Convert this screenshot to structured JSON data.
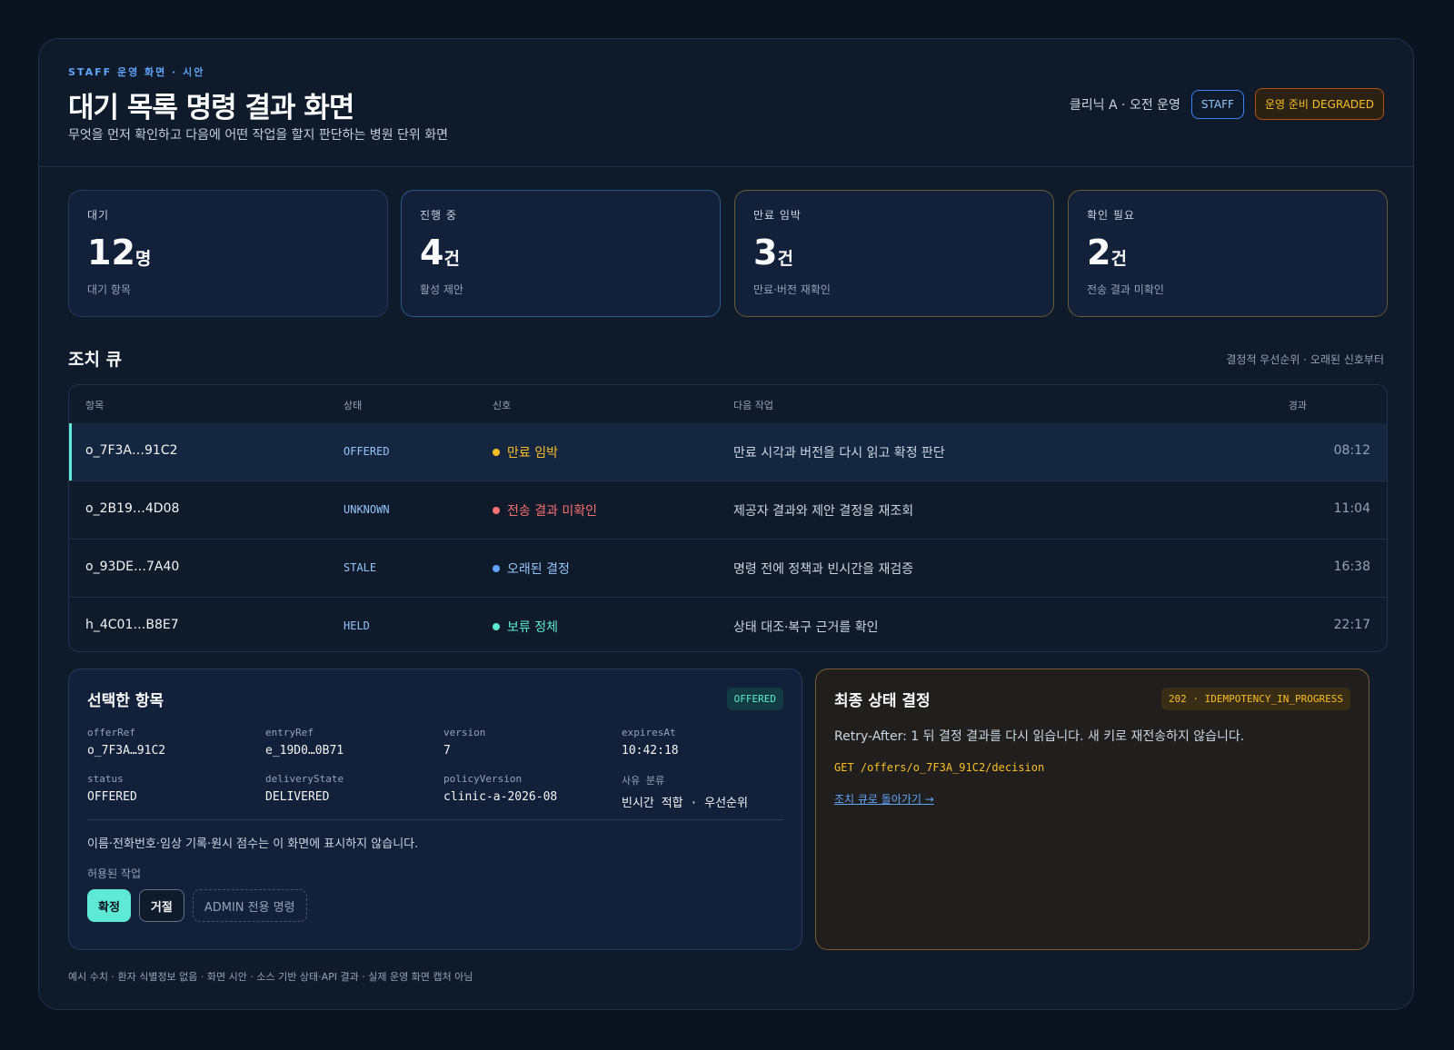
{
  "header": {
    "eyebrow": "STAFF 운영 화면 · 시안",
    "title": "대기 목록 명령 결과 화면",
    "subtitle": "무엇을 먼저 확인하고 다음에 어떤 작업을 할지 판단하는 병원 단위 화면",
    "clinic": "클리닉 A · 오전 운영",
    "role_badge": "STAFF",
    "ops_badge": "운영 준비 DEGRADED"
  },
  "stats": [
    {
      "label": "대기",
      "value": "12",
      "unit": "명",
      "desc": "대기 항목"
    },
    {
      "label": "진행 중",
      "value": "4",
      "unit": "건",
      "desc": "활성 제안"
    },
    {
      "label": "만료 임박",
      "value": "3",
      "unit": "건",
      "desc": "만료·버전 재확인"
    },
    {
      "label": "확인 필요",
      "value": "2",
      "unit": "건",
      "desc": "전송 결과 미확인"
    }
  ],
  "queue": {
    "title": "조치 큐",
    "note": "결정적 우선순위 · 오래된 신호부터",
    "columns": {
      "item": "항목",
      "state": "상태",
      "signal": "신호",
      "next": "다음 작업",
      "elapsed": "경과"
    },
    "rows": [
      {
        "id": "o_7F3A…91C2",
        "state": "OFFERED",
        "signal": "만료 임박",
        "next": "만료 시각과 버전을 다시 읽고 확정 판단",
        "elapsed": "08:12"
      },
      {
        "id": "o_2B19…4D08",
        "state": "UNKNOWN",
        "signal": "전송 결과 미확인",
        "next": "제공자 결과와 제안 결정을 재조회",
        "elapsed": "11:04"
      },
      {
        "id": "o_93DE…7A40",
        "state": "STALE",
        "signal": "오래된 결정",
        "next": "명령 전에 정책과 빈시간을 재검증",
        "elapsed": "16:38"
      },
      {
        "id": "h_4C01…B8E7",
        "state": "HELD",
        "signal": "보류 정체",
        "next": "상태 대조·복구 근거를 확인",
        "elapsed": "22:17"
      }
    ]
  },
  "selected": {
    "title": "선택한 항목",
    "status_pill": "OFFERED",
    "fields": [
      {
        "key": "offerRef",
        "value": "o_7F3A…91C2"
      },
      {
        "key": "entryRef",
        "value": "e_19D0…0B71"
      },
      {
        "key": "version",
        "value": "7"
      },
      {
        "key": "expiresAt",
        "value": "10:42:18"
      },
      {
        "key": "status",
        "value": "OFFERED"
      },
      {
        "key": "deliveryState",
        "value": "DELIVERED"
      },
      {
        "key": "policyVersion",
        "value": "clinic-a-2026-08"
      },
      {
        "key": "사유 분류",
        "value": "빈시간 적합 · 우선순위"
      }
    ],
    "notice": "이름·전화번호·임상 기록·원시 점수는 이 화면에 표시하지 않습니다.",
    "actions_label": "허용된 작업",
    "actions": {
      "confirm": "확정",
      "reject": "거절",
      "admin": "ADMIN 전용 명령"
    }
  },
  "final": {
    "title": "최종 상태 결정",
    "code_pill": "202 · IDEMPOTENCY_IN_PROGRESS",
    "retry": "Retry-After: 1 뒤 결정 결과를 다시 읽습니다. 새 키로 재전송하지 않습니다.",
    "endpoint": "GET /offers/o_7F3A_91C2/decision",
    "back_link": "조치 큐로 돌아가기 →"
  },
  "footer": "예시 수치 · 환자 식별정보 없음 · 화면 시안 · 소스 기반 상태·API 결과 · 실제 운영 화면 캡처 아님",
  "colors": {
    "accent_teal": "#5eead4",
    "signal_amber": "#fbbf24",
    "signal_red": "#f87171",
    "signal_blue": "#60a5fa",
    "signal_green": "#5eead4"
  }
}
